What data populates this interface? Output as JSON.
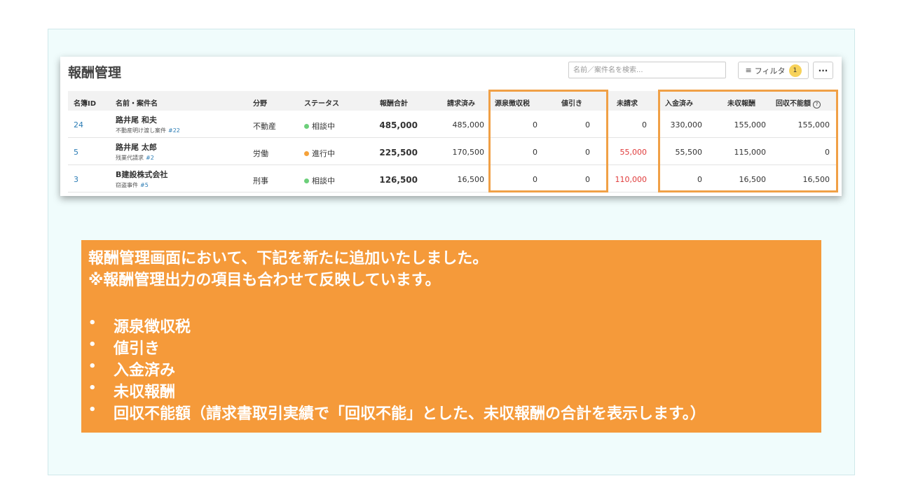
{
  "panel": {
    "title": "報酬管理",
    "search_placeholder": "名前／案件名を検索...",
    "filter_label": "フィルタ",
    "filter_count": "1",
    "more_label": "···"
  },
  "table": {
    "headers": {
      "id": "名簿ID",
      "name": "名前・案件名",
      "field": "分野",
      "status": "ステータス",
      "total": "報酬合計",
      "billed": "請求済み",
      "withholding": "源泉徴収税",
      "discount": "値引き",
      "unbilled": "未請求",
      "received": "入金済み",
      "uncollected": "未収報酬",
      "bad_debt": "回収不能額"
    },
    "rows": [
      {
        "id": "24",
        "name": "路井尾 和夫",
        "case_name": "不動産明け渡し案件",
        "case_no": "#22",
        "field": "不動産",
        "status": "相談中",
        "status_color": "#6ccf7a",
        "total": "485,000",
        "billed": "485,000",
        "withholding": "0",
        "discount": "0",
        "unbilled": "0",
        "received": "330,000",
        "uncollected": "155,000",
        "bad_debt": "155,000"
      },
      {
        "id": "5",
        "name": "路井尾 太郎",
        "case_name": "残業代請求",
        "case_no": "#2",
        "field": "労働",
        "status": "進行中",
        "status_color": "#f5a23a",
        "total": "225,500",
        "billed": "170,500",
        "withholding": "0",
        "discount": "0",
        "unbilled": "55,000",
        "received": "55,500",
        "uncollected": "115,000",
        "bad_debt": "0"
      },
      {
        "id": "3",
        "name": "B建設株式会社",
        "case_name": "窃盗事件",
        "case_no": "#5",
        "field": "刑事",
        "status": "相談中",
        "status_color": "#6ccf7a",
        "total": "126,500",
        "billed": "16,500",
        "withholding": "0",
        "discount": "0",
        "unbilled": "110,000",
        "received": "0",
        "uncollected": "16,500",
        "bad_debt": "16,500"
      }
    ]
  },
  "note": {
    "line1": "報酬管理画面において、下記を新たに追加いたしました。",
    "line2": "※報酬管理出力の項目も合わせて反映しています。",
    "bullets": [
      "源泉徴収税",
      "値引き",
      "入金済み",
      "未収報酬",
      "回収不能額（請求書取引実績で「回収不能」とした、未収報酬の合計を表示します。）"
    ],
    "bullet_char": "•"
  },
  "colors": {
    "highlight": "#f0a046",
    "note_bg": "#f59a3a",
    "link": "#2b7cb5",
    "negative": "#e03b3b"
  }
}
